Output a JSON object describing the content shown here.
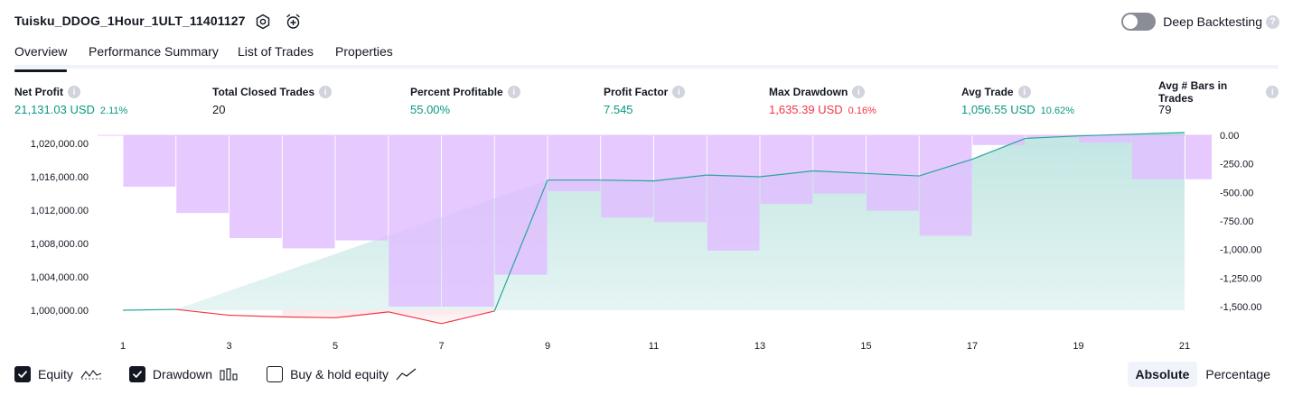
{
  "header": {
    "title": "Tuisku_DDOG_1Hour_1ULT_11401127",
    "deep_backtesting_label": "Deep Backtesting",
    "deep_backtesting_enabled": false
  },
  "tabs": [
    {
      "label": "Overview",
      "active": true
    },
    {
      "label": "Performance Summary",
      "active": false
    },
    {
      "label": "List of Trades",
      "active": false
    },
    {
      "label": "Properties",
      "active": false
    }
  ],
  "metrics": [
    {
      "label": "Net Profit",
      "value": "21,131.03 USD",
      "sub": "2.11%",
      "tone": "pos"
    },
    {
      "label": "Total Closed Trades",
      "value": "20",
      "sub": "",
      "tone": "neutral"
    },
    {
      "label": "Percent Profitable",
      "value": "55.00%",
      "sub": "",
      "tone": "pos"
    },
    {
      "label": "Profit Factor",
      "value": "7.545",
      "sub": "",
      "tone": "pos"
    },
    {
      "label": "Max Drawdown",
      "value": "1,635.39 USD",
      "sub": "0.16%",
      "tone": "neg"
    },
    {
      "label": "Avg Trade",
      "value": "1,056.55 USD",
      "sub": "10.62%",
      "tone": "pos"
    },
    {
      "label": "Avg # Bars in Trades",
      "value": "79",
      "sub": "",
      "tone": "neutral"
    }
  ],
  "chart_data": {
    "type": "line",
    "x_tick_labels": [
      "1",
      "3",
      "5",
      "7",
      "9",
      "11",
      "13",
      "15",
      "17",
      "19",
      "21"
    ],
    "x_range": [
      1,
      21
    ],
    "left_axis": {
      "tick_labels": [
        "1,020,000.00",
        "1,016,000.00",
        "1,012,000.00",
        "1,008,000.00",
        "1,004,000.00",
        "1,000,000.00"
      ],
      "ticks": [
        1020000,
        1016000,
        1012000,
        1008000,
        1004000,
        1000000
      ]
    },
    "right_axis": {
      "tick_labels": [
        "0.00",
        "-250.00",
        "-500.00",
        "-750.00",
        "-1,000.00",
        "-1,250.00",
        "-1,500.00"
      ],
      "ticks": [
        0,
        -250,
        -500,
        -750,
        -1000,
        -1250,
        -1500
      ]
    },
    "series": [
      {
        "name": "Equity",
        "x": [
          1,
          2,
          3,
          4,
          5,
          6,
          7,
          8,
          9,
          10,
          11,
          12,
          13,
          14,
          15,
          16,
          17,
          18,
          19,
          20,
          21
        ],
        "values": [
          1000000,
          1000100,
          999400,
          999200,
          999100,
          999800,
          998400,
          999900,
          1015600,
          1015600,
          1015500,
          1016200,
          1016000,
          1016700,
          1016400,
          1016100,
          1018100,
          1020600,
          1020900,
          1021100,
          1021300
        ]
      },
      {
        "name": "Drawdown",
        "x": [
          1,
          2,
          3,
          4,
          5,
          6,
          7,
          8,
          9,
          10,
          11,
          12,
          13,
          14,
          15,
          16,
          17,
          18,
          19,
          20,
          21
        ],
        "values": [
          0,
          -450,
          -680,
          -900,
          -990,
          -920,
          -1500,
          -1500,
          -1220,
          -490,
          -720,
          -760,
          -1010,
          -600,
          -510,
          -660,
          -880,
          -85,
          -20,
          -65,
          -385
        ]
      }
    ],
    "legend": [
      {
        "label": "Equity",
        "checked": true
      },
      {
        "label": "Drawdown",
        "checked": true
      },
      {
        "label": "Buy & hold equity",
        "checked": false
      }
    ],
    "colors": {
      "equity_up": "#26a69a",
      "equity_down": "#f23645",
      "equity_fill": "#26a69a",
      "drawdown_fill": "#e1bfff",
      "drawdown_overlap": "#b0b5e0"
    },
    "modes": [
      {
        "label": "Absolute",
        "active": true
      },
      {
        "label": "Percentage",
        "active": false
      }
    ]
  }
}
